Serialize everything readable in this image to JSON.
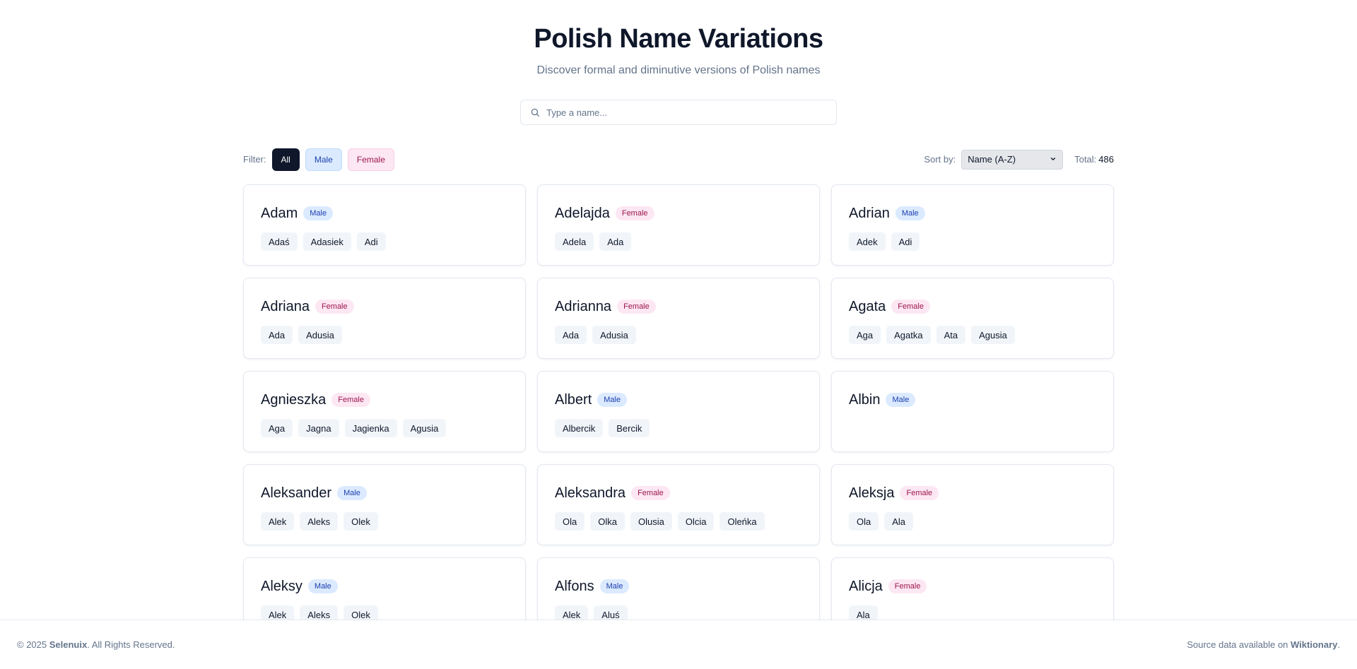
{
  "header": {
    "title": "Polish Name Variations",
    "subtitle": "Discover formal and diminutive versions of Polish names"
  },
  "search": {
    "placeholder": "Type a name...",
    "icon": "search-icon"
  },
  "filter": {
    "label": "Filter:",
    "options": [
      {
        "label": "All",
        "active": true
      },
      {
        "label": "Male",
        "active": false
      },
      {
        "label": "Female",
        "active": false
      }
    ]
  },
  "sort": {
    "label": "Sort by:",
    "selected": "Name (A-Z)"
  },
  "total": {
    "label": "Total:",
    "value": "486"
  },
  "names": [
    {
      "name": "Adam",
      "gender": "Male",
      "variants": [
        "Adaś",
        "Adasiek",
        "Adi"
      ]
    },
    {
      "name": "Adelajda",
      "gender": "Female",
      "variants": [
        "Adela",
        "Ada"
      ]
    },
    {
      "name": "Adrian",
      "gender": "Male",
      "variants": [
        "Adek",
        "Adi"
      ]
    },
    {
      "name": "Adriana",
      "gender": "Female",
      "variants": [
        "Ada",
        "Adusia"
      ]
    },
    {
      "name": "Adrianna",
      "gender": "Female",
      "variants": [
        "Ada",
        "Adusia"
      ]
    },
    {
      "name": "Agata",
      "gender": "Female",
      "variants": [
        "Aga",
        "Agatka",
        "Ata",
        "Agusia"
      ]
    },
    {
      "name": "Agnieszka",
      "gender": "Female",
      "variants": [
        "Aga",
        "Jagna",
        "Jagienka",
        "Agusia"
      ]
    },
    {
      "name": "Albert",
      "gender": "Male",
      "variants": [
        "Albercik",
        "Bercik"
      ]
    },
    {
      "name": "Albin",
      "gender": "Male",
      "variants": []
    },
    {
      "name": "Aleksander",
      "gender": "Male",
      "variants": [
        "Alek",
        "Aleks",
        "Olek"
      ]
    },
    {
      "name": "Aleksandra",
      "gender": "Female",
      "variants": [
        "Ola",
        "Olka",
        "Olusia",
        "Olcia",
        "Oleńka"
      ]
    },
    {
      "name": "Aleksja",
      "gender": "Female",
      "variants": [
        "Ola",
        "Ala"
      ]
    },
    {
      "name": "Aleksy",
      "gender": "Male",
      "variants": [
        "Alek",
        "Aleks",
        "Olek"
      ]
    },
    {
      "name": "Alfons",
      "gender": "Male",
      "variants": [
        "Alek",
        "Aluś"
      ]
    },
    {
      "name": "Alicja",
      "gender": "Female",
      "variants": [
        "Ala"
      ]
    }
  ],
  "footer": {
    "copyright_prefix": "© 2025 ",
    "company": "Selenuix",
    "copyright_suffix": ". All Rights Reserved.",
    "source_prefix": "Source data available on ",
    "source_link": "Wiktionary",
    "source_suffix": "."
  }
}
